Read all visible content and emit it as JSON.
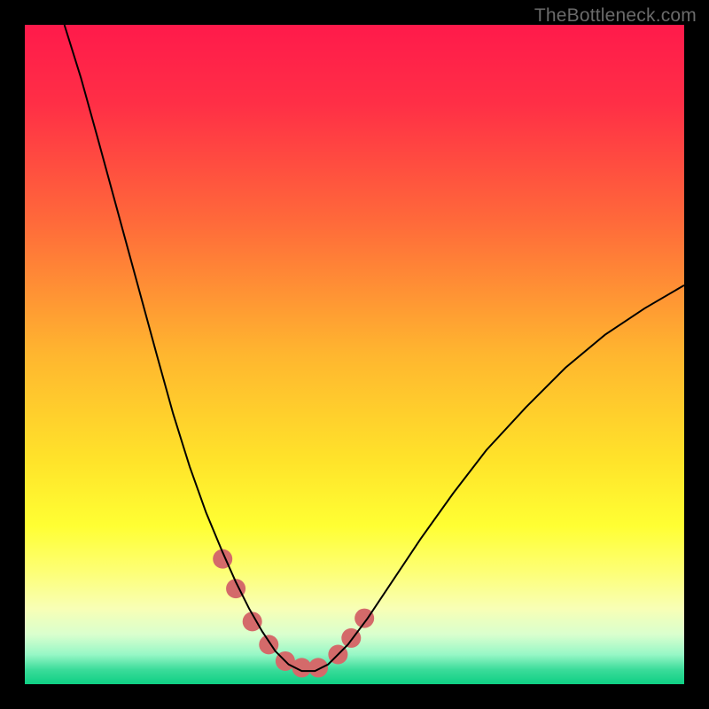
{
  "watermark": "TheBottleneck.com",
  "chart_data": {
    "type": "line",
    "title": "",
    "xlabel": "",
    "ylabel": "",
    "xlim": [
      0,
      1
    ],
    "ylim": [
      0,
      1
    ],
    "background_gradient": {
      "stops": [
        {
          "offset": 0.0,
          "color": "#ff1a4b"
        },
        {
          "offset": 0.12,
          "color": "#ff2f46"
        },
        {
          "offset": 0.3,
          "color": "#ff6a3a"
        },
        {
          "offset": 0.5,
          "color": "#ffb62f"
        },
        {
          "offset": 0.66,
          "color": "#ffe32a"
        },
        {
          "offset": 0.76,
          "color": "#ffff33"
        },
        {
          "offset": 0.83,
          "color": "#fdff76"
        },
        {
          "offset": 0.885,
          "color": "#f8ffb5"
        },
        {
          "offset": 0.925,
          "color": "#d9ffce"
        },
        {
          "offset": 0.955,
          "color": "#97f7c6"
        },
        {
          "offset": 0.978,
          "color": "#3bdc9a"
        },
        {
          "offset": 1.0,
          "color": "#0ecf84"
        }
      ]
    },
    "series": [
      {
        "name": "bottleneck-curve",
        "color": "#000000",
        "width": 2,
        "x": [
          0.06,
          0.085,
          0.11,
          0.14,
          0.17,
          0.2,
          0.225,
          0.25,
          0.275,
          0.3,
          0.32,
          0.34,
          0.36,
          0.38,
          0.4,
          0.42,
          0.44,
          0.46,
          0.49,
          0.52,
          0.56,
          0.6,
          0.65,
          0.7,
          0.76,
          0.82,
          0.88,
          0.94,
          1.0
        ],
        "y": [
          1.0,
          0.92,
          0.83,
          0.72,
          0.61,
          0.5,
          0.41,
          0.33,
          0.26,
          0.2,
          0.155,
          0.115,
          0.08,
          0.05,
          0.03,
          0.02,
          0.02,
          0.03,
          0.06,
          0.1,
          0.16,
          0.22,
          0.29,
          0.355,
          0.42,
          0.48,
          0.53,
          0.57,
          0.605
        ]
      },
      {
        "name": "highlight-dots",
        "color": "#d46a6a",
        "type": "scatter",
        "radius": 11,
        "x": [
          0.3,
          0.32,
          0.345,
          0.37,
          0.395,
          0.42,
          0.445,
          0.475,
          0.495,
          0.515
        ],
        "y": [
          0.19,
          0.145,
          0.095,
          0.06,
          0.035,
          0.025,
          0.025,
          0.045,
          0.07,
          0.1
        ]
      }
    ]
  }
}
